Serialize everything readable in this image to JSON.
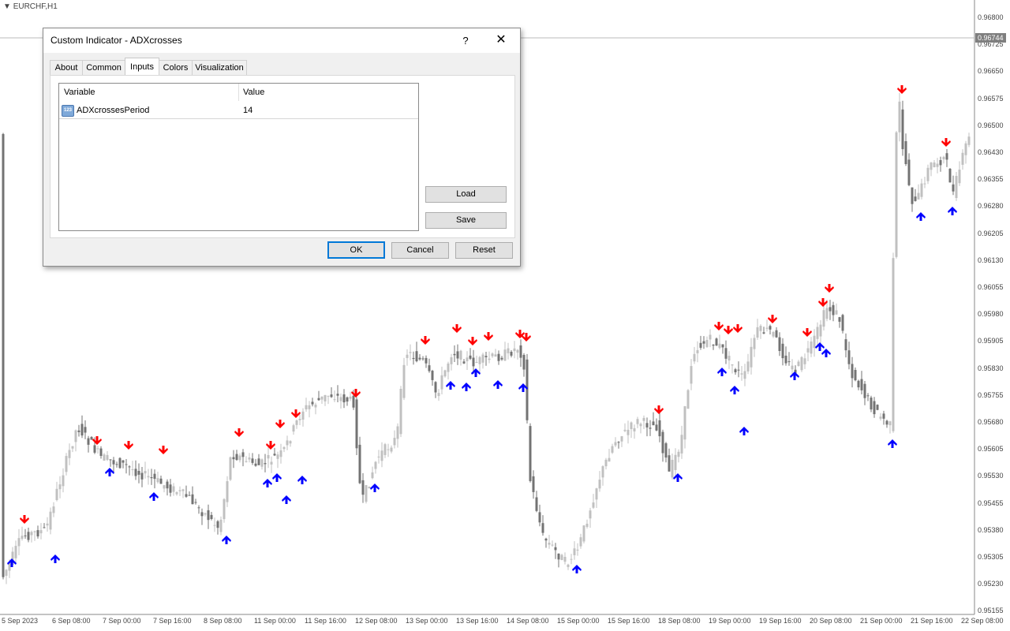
{
  "chart": {
    "symbol": "EURCHF,H1",
    "current_price": "0.96744",
    "price_labels": [
      "0.96800",
      "0.96725",
      "0.96650",
      "0.96575",
      "0.96500",
      "0.96430",
      "0.96355",
      "0.96280",
      "0.96205",
      "0.96130",
      "0.96055",
      "0.95980",
      "0.95905",
      "0.95830",
      "0.95755",
      "0.95680",
      "0.95605",
      "0.95530",
      "0.95455",
      "0.95380",
      "0.95305",
      "0.95230",
      "0.95155"
    ],
    "time_labels": [
      "5 Sep 2023",
      "6 Sep 08:00",
      "7 Sep 00:00",
      "7 Sep 16:00",
      "8 Sep 08:00",
      "11 Sep 00:00",
      "11 Sep 16:00",
      "12 Sep 08:00",
      "13 Sep 00:00",
      "13 Sep 16:00",
      "14 Sep 08:00",
      "15 Sep 00:00",
      "15 Sep 16:00",
      "18 Sep 08:00",
      "19 Sep 00:00",
      "19 Sep 16:00",
      "20 Sep 08:00",
      "21 Sep 00:00",
      "21 Sep 16:00",
      "22 Sep 08:00"
    ],
    "colors": {
      "bull": "#c0c0c0",
      "bear": "#737373",
      "sell_arrow": "#ff0000",
      "buy_arrow": "#0000ff"
    }
  },
  "dialog": {
    "title": "Custom Indicator - ADXcrosses",
    "help_label": "?",
    "close_label": "✕",
    "tabs": [
      {
        "label": "About"
      },
      {
        "label": "Common"
      },
      {
        "label": "Inputs",
        "active": true
      },
      {
        "label": "Colors"
      },
      {
        "label": "Visualization"
      }
    ],
    "table": {
      "col_variable": "Variable",
      "col_value": "Value",
      "rows": [
        {
          "icon": "123",
          "variable": "ADXcrossesPeriod",
          "value": "14"
        }
      ]
    },
    "buttons": {
      "load": "Load",
      "save": "Save",
      "ok": "OK",
      "cancel": "Cancel",
      "reset": "Reset"
    }
  }
}
